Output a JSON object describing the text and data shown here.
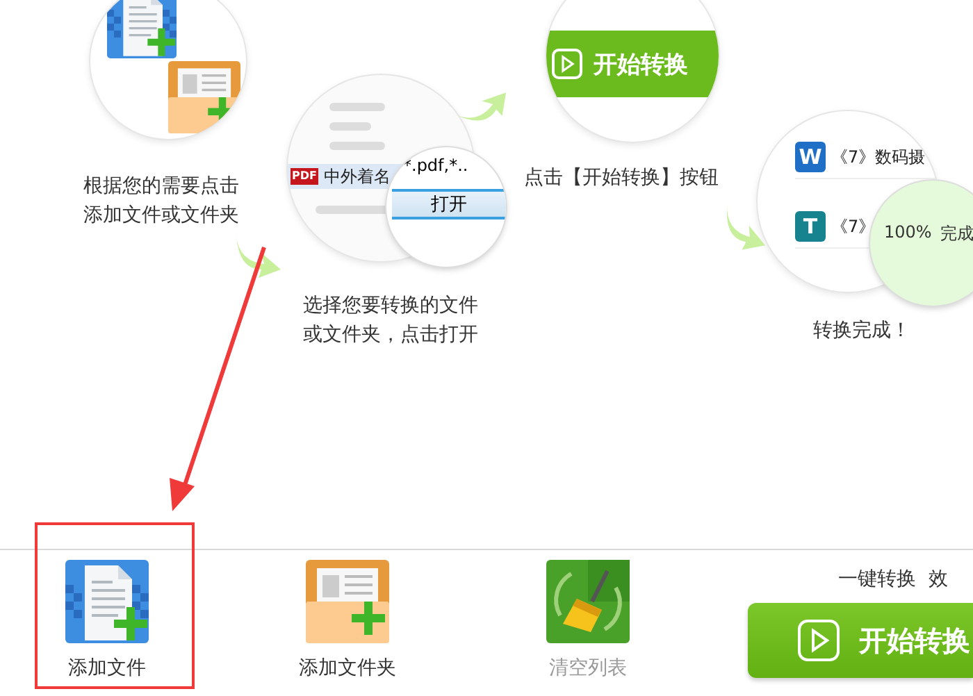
{
  "steps": [
    {
      "caption": [
        "根据您的需要点击",
        "添加文件或文件夹"
      ]
    },
    {
      "caption": [
        "选择您要转换的文件",
        "或文件夹，点击打开"
      ]
    },
    {
      "caption": [
        "点击【开始转换】按钮"
      ]
    },
    {
      "caption": [
        "转换完成！"
      ]
    }
  ],
  "dialog": {
    "pdf_badge": "PDF",
    "file_name": "中外着名",
    "filter": "*.pdf,*..",
    "open_button": "打开"
  },
  "start_preview": {
    "label": "开始转换"
  },
  "result_list": {
    "rows": [
      {
        "kind": "word",
        "icon_letter": "W",
        "title": "《7》数码摄"
      },
      {
        "kind": "text",
        "icon_letter": "T",
        "title": "《7》"
      }
    ],
    "progress": {
      "reading": "100%",
      "status": "完成"
    }
  },
  "toolbar": {
    "buttons": [
      {
        "kind": "add-file",
        "label": "添加文件",
        "disabled": false,
        "highlighted": true
      },
      {
        "kind": "add-folder",
        "label": "添加文件夹",
        "disabled": false,
        "highlighted": false
      },
      {
        "kind": "clear",
        "label": "清空列表",
        "disabled": true,
        "highlighted": false
      }
    ],
    "hint": "一键转换  效",
    "start_button": "开始转换"
  }
}
